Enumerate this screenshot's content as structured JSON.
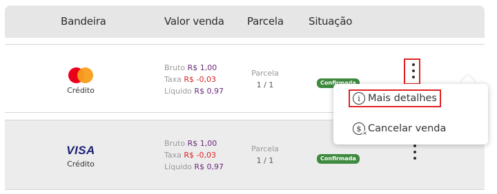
{
  "columns": {
    "bandeira": "Bandeira",
    "valor_venda": "Valor venda",
    "parcela": "Parcela",
    "situacao": "Situação"
  },
  "rows": [
    {
      "brand": "mastercard",
      "brand_text": "",
      "type": "Crédito",
      "bruto_label": "Bruto",
      "bruto": "R$ 1,00",
      "taxa_label": "Taxa",
      "taxa": "R$ -0,03",
      "liquido_label": "Líquido",
      "liquido": "R$ 0,97",
      "parcela_label": "Parcela",
      "parcela": "1 / 1",
      "status": "Confirmada",
      "status_color": "#3e8a3e"
    },
    {
      "brand": "visa",
      "brand_text": "VISA",
      "type": "Crédito",
      "bruto_label": "Bruto",
      "bruto": "R$ 1,00",
      "taxa_label": "Taxa",
      "taxa": "R$ -0,03",
      "liquido_label": "Líquido",
      "liquido": "R$ 0,97",
      "parcela_label": "Parcela",
      "parcela": "1 / 1",
      "status": "Confirmada",
      "status_color": "#3e8a3e"
    }
  ],
  "context_menu": {
    "items": [
      {
        "label": "Mais detalhes",
        "icon": "info-icon"
      },
      {
        "label": "Cancelar venda",
        "icon": "cancel-money-icon"
      }
    ]
  },
  "colors": {
    "highlight": "#e02020",
    "value_positive": "#6a2a7a",
    "value_negative": "#e02020"
  }
}
